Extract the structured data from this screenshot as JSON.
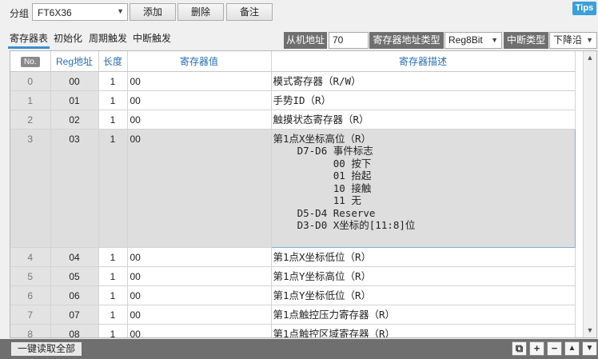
{
  "toolbar": {
    "group_label": "分组",
    "group_value": "FT6X36",
    "add_label": "添加",
    "delete_label": "删除",
    "note_label": "备注",
    "tips_label": "Tips"
  },
  "tabs": [
    {
      "label": "寄存器表",
      "active": true
    },
    {
      "label": "初始化",
      "active": false
    },
    {
      "label": "周期触发",
      "active": false
    },
    {
      "label": "中断触发",
      "active": false
    }
  ],
  "filters": {
    "slave_addr_label": "从机地址",
    "slave_addr_value": "70",
    "reg_addr_type_label": "寄存器地址类型",
    "reg_addr_type_value": "Reg8Bit",
    "irq_type_label": "中断类型",
    "irq_type_value": "下降沿"
  },
  "table": {
    "headers": {
      "no": "No.",
      "addr": "Reg地址",
      "len": "长度",
      "value": "寄存器值",
      "desc": "寄存器描述"
    },
    "rows": [
      {
        "no": "0",
        "addr": "00",
        "len": "1",
        "value": "00",
        "desc": "模式寄存器（R/W）"
      },
      {
        "no": "1",
        "addr": "01",
        "len": "1",
        "value": "00",
        "desc": "手势ID（R）"
      },
      {
        "no": "2",
        "addr": "02",
        "len": "1",
        "value": "00",
        "desc": "触摸状态寄存器（R）"
      },
      {
        "no": "3",
        "addr": "03",
        "len": "1",
        "value": "00",
        "desc": "第1点X坐标高位（R）\n    D7-D6 事件标志\n          00 按下\n          01 抬起\n          10 接触\n          11 无\n    D5-D4 Reserve\n    D3-D0 X坐标的[11:8]位"
      },
      {
        "no": "4",
        "addr": "04",
        "len": "1",
        "value": "00",
        "desc": "第1点X坐标低位（R）"
      },
      {
        "no": "5",
        "addr": "05",
        "len": "1",
        "value": "00",
        "desc": "第1点Y坐标高位（R）"
      },
      {
        "no": "6",
        "addr": "06",
        "len": "1",
        "value": "00",
        "desc": "第1点Y坐标低位（R）"
      },
      {
        "no": "7",
        "addr": "07",
        "len": "1",
        "value": "00",
        "desc": "第1点触控压力寄存器（R）"
      },
      {
        "no": "8",
        "addr": "08",
        "len": "1",
        "value": "00",
        "desc": "第1点触控区域寄存器（R）"
      }
    ]
  },
  "bottom": {
    "read_all_label": "一键读取全部",
    "buttons": [
      {
        "icon": "copy-icon",
        "glyph": "⧉"
      },
      {
        "icon": "plus-icon",
        "glyph": "+"
      },
      {
        "icon": "minus-icon",
        "glyph": "−"
      },
      {
        "icon": "up-icon",
        "glyph": "▲"
      },
      {
        "icon": "down-icon",
        "glyph": "▼"
      }
    ]
  }
}
